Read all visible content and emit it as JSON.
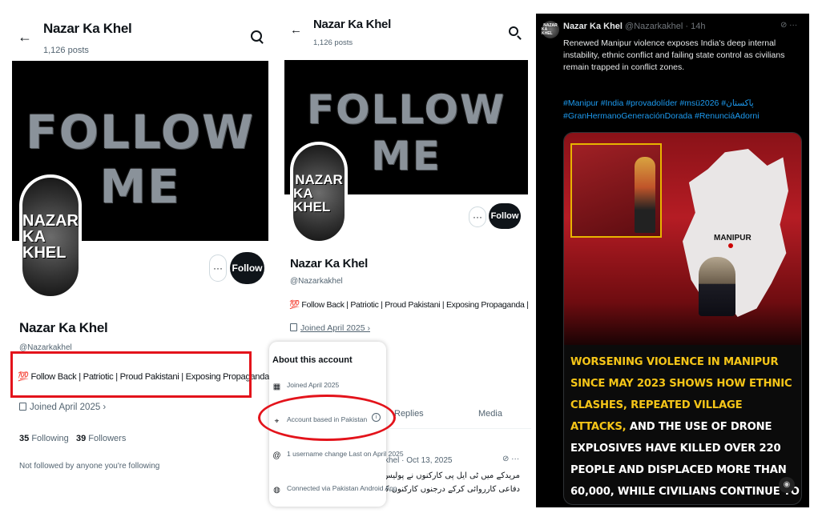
{
  "colors": {
    "accent_red": "#e3131b",
    "link_blue": "#1d9bf0",
    "caption_yellow": "#f5c518",
    "dark": "#0f1419",
    "muted": "#536471"
  },
  "panel1": {
    "header": {
      "back_icon": "arrow-left-icon",
      "title": "Nazar Ka Khel",
      "posts": "1,126 posts",
      "search_icon": "search-icon"
    },
    "banner_text": "FOLLOW ME",
    "avatar_line1": "NAZAR",
    "avatar_line2": "KA KHEL",
    "more_label": "···",
    "follow_label": "Follow",
    "name": "Nazar Ka Khel",
    "handle": "@Nazarkakhel",
    "bio": "💯 Follow Back | Patriotic | Proud Pakistani | Exposing Propaganda | Facts ✍️",
    "joined": "Joined April 2025 ›",
    "following_count": "35",
    "following_label": "Following",
    "followers_count": "39",
    "followers_label": "Followers",
    "not_followed": "Not followed by anyone you're following"
  },
  "panel2": {
    "header": {
      "back_icon": "arrow-left-icon",
      "title": "Nazar Ka Khel",
      "posts": "1,126 posts",
      "search_icon": "search-icon"
    },
    "banner_text": "FOLLOW ME",
    "avatar_line1": "NAZAR",
    "avatar_line2": "KA KHEL",
    "more_label": "···",
    "follow_label": "Follow",
    "name": "Nazar Ka Khel",
    "handle": "@Nazarkakhel",
    "bio": "💯 Follow Back | Patriotic | Proud Pakistani | Exposing Propaganda | Facts ✍️",
    "joined": "Joined April 2025 ›",
    "tabs": {
      "replies": "Replies",
      "media": "Media"
    },
    "tweet_meta": "khel · Oct 13, 2025",
    "tweet_urdu_1": "مریدکے میں ٹی ایل پی کارکنوں نے پولیس پر پتھراؤ، اور فا",
    "tweet_urdu_2": "دفاعی کارروائی کرکے درجنوں کارکنوں کو گرفتار کر لیا۔",
    "popup": {
      "title": "About this account",
      "rows": [
        {
          "icon": "calendar-icon",
          "text": "Joined April 2025"
        },
        {
          "icon": "location-pin-icon",
          "text": "Account based in Pakistan"
        },
        {
          "icon": "at-sign-icon",
          "text": "1 username change Last on April 2025"
        },
        {
          "icon": "globe-icon",
          "text": "Connected via Pakistan Android App"
        }
      ]
    }
  },
  "panel3": {
    "author_name": "Nazar Ka Khel",
    "author_meta": "@Nazarkakhel · 14h",
    "avatar_line1": "NAZAR",
    "avatar_line2": "KA KHEL",
    "text": "Renewed Manipur violence exposes India's deep internal instability, ethnic conflict and failing state control as civilians remain trapped in conflict zones.",
    "hashtags": "#Manipur #India #provadolíder #msü2026 #پاکستان #GranHermanoGeneraciónDorada #RenunciáAdorni",
    "map_label": "MANIPUR",
    "caption_yellow": "WORSENING VIOLENCE IN MANIPUR SINCE MAY 2023 SHOWS HOW ETHNIC CLASHES, REPEATED VILLAGE ATTACKS,",
    "caption_white": " AND THE USE OF DRONE EXPLOSIVES HAVE KILLED OVER 220 PEOPLE AND DISPLACED MORE THAN 60,000, WHILE CIVILIANS CONTINUE TO REMAIN UNPROTECTED"
  }
}
